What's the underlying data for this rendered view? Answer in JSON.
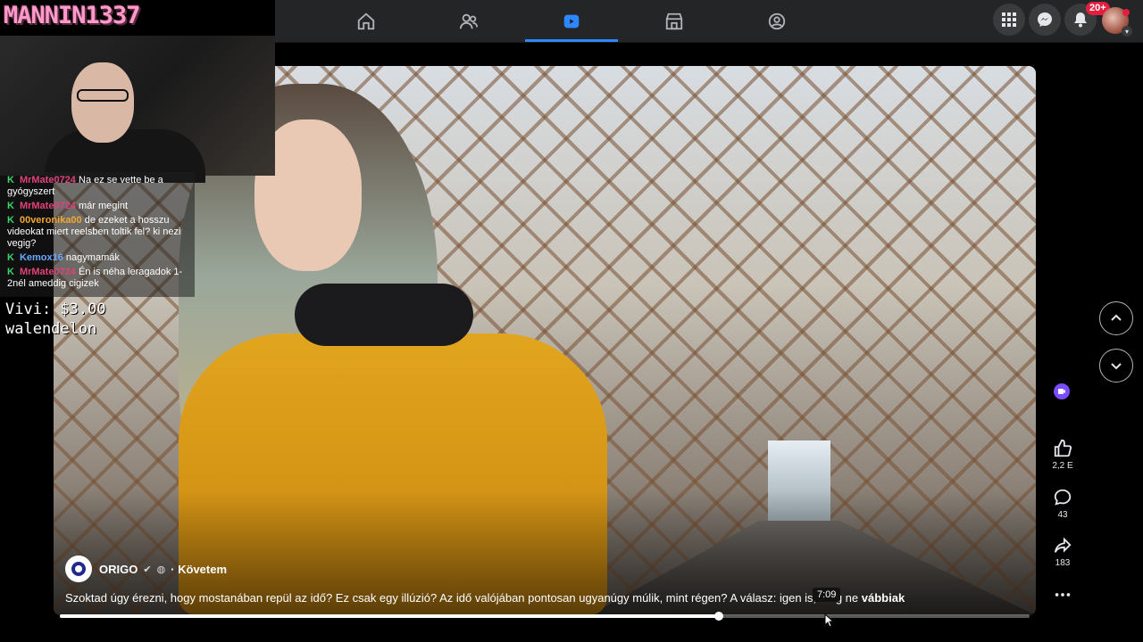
{
  "streamer": {
    "name": "MANNIN1337"
  },
  "chat": [
    {
      "user": "MrMate0724",
      "user_color": "#e0417a",
      "text": "Na ez se vette be a gyógyszert"
    },
    {
      "user": "MrMate0724",
      "user_color": "#e0417a",
      "text": "már megint"
    },
    {
      "user": "00veronika00",
      "user_color": "#f0a830",
      "text": "de ezeket a hosszu videokat miert reelsben toltik fel? ki nezi vegig?"
    },
    {
      "user": "Kemox16",
      "user_color": "#6aa8ff",
      "text": "nagymamák"
    },
    {
      "user": "MrMate0724",
      "user_color": "#e0417a",
      "text": "Én is néha leragadok 1-2nél ameddig cigizek"
    }
  ],
  "donation": {
    "amount_line": "Vivi: $3.00",
    "name_line": "walendelon"
  },
  "topnav": {
    "tabs": [
      {
        "name": "home",
        "icon": "home-icon",
        "active": false
      },
      {
        "name": "friends",
        "icon": "friends-icon",
        "active": false
      },
      {
        "name": "video",
        "icon": "video-icon",
        "active": true
      },
      {
        "name": "marketplace",
        "icon": "marketplace-icon",
        "active": false
      },
      {
        "name": "groups",
        "icon": "groups-icon",
        "active": false
      }
    ],
    "notifications_badge": "20+",
    "accent_color": "#2d88ff"
  },
  "reel": {
    "page_name": "ORIGO",
    "follow_label": "· Követem",
    "caption": "Szoktad úgy érezni, hogy mostanában repül az idő? Ez csak egy illúzió? Az idő valójában pontosan ugyanúgy múlik, mint régen? A válasz: igen is, meg ne",
    "see_more": "vábbiak",
    "hover_time": "7:09",
    "progress": 0.68,
    "likes": "2,2 E",
    "comments": "43",
    "shares": "183"
  }
}
